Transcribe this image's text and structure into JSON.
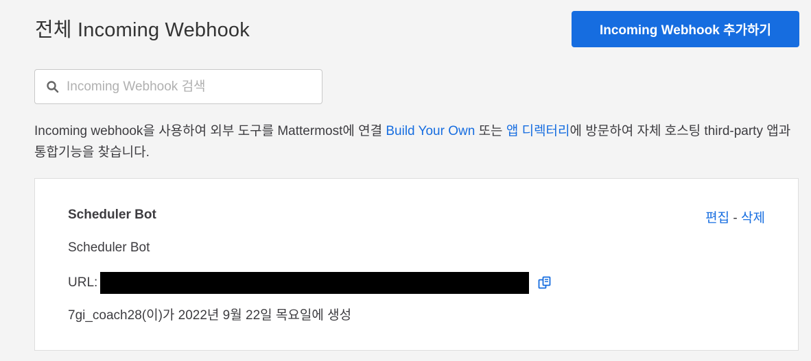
{
  "header": {
    "title": "전체 Incoming Webhook",
    "add_button_label": "Incoming Webhook 추가하기"
  },
  "search": {
    "placeholder": "Incoming Webhook 검색",
    "value": ""
  },
  "description": {
    "part1": "Incoming webhook을 사용하여 외부 도구를 Mattermost에 연결 ",
    "link1": "Build Your Own",
    "part2": " 또는 ",
    "link2": "앱 디렉터리",
    "part3": "에 방문하여 자체 호스팅 third-party 앱과 통합기능을 찾습니다."
  },
  "webhooks": [
    {
      "name": "Scheduler Bot",
      "description": "Scheduler Bot",
      "url_label": "URL:",
      "created": "7gi_coach28(이)가 2022년 9월 22일 목요일에 생성",
      "edit_label": "편집",
      "separator": " - ",
      "delete_label": "삭제"
    }
  ],
  "colors": {
    "accent": "#166de0",
    "background": "#f4f4f4"
  },
  "icons": {
    "search": "search-icon",
    "copy": "copy-icon"
  }
}
